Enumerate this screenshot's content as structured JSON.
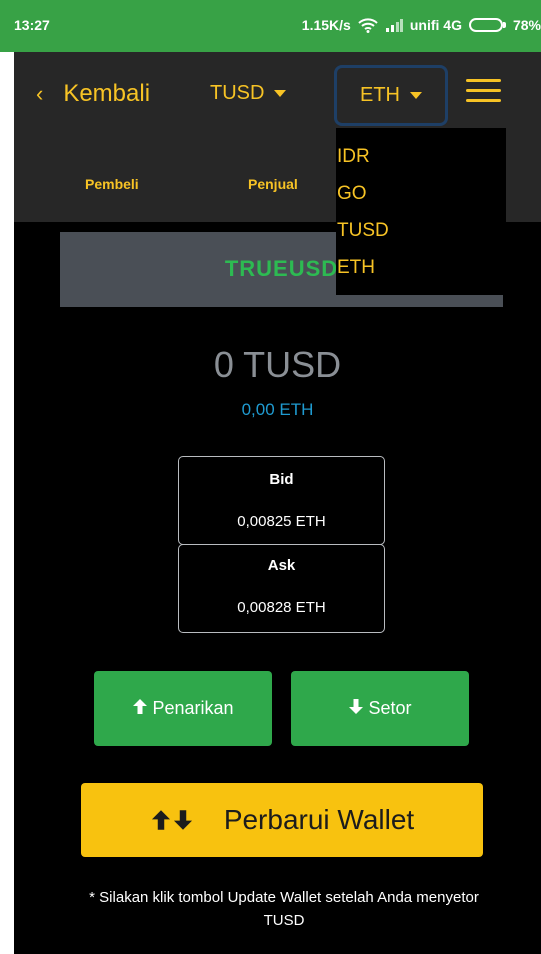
{
  "status_bar": {
    "time": "13:27",
    "network_speed": "1.15K/s",
    "carrier": "unifi 4G",
    "battery": "78%",
    "battery_level": 0.78
  },
  "navbar": {
    "back_label": "Kembali",
    "base_currency": "TUSD",
    "quote_currency": "ETH"
  },
  "subnav": {
    "tabs": [
      "Pembeli",
      "Penjual"
    ]
  },
  "dropdown": {
    "options": [
      "IDR",
      "GO",
      "TUSD",
      "ETH"
    ]
  },
  "wallet": {
    "coin_name": "TRUEUSD",
    "balance": "0 TUSD",
    "balance_converted": "0,00 ETH"
  },
  "prices": {
    "bid_label": "Bid",
    "bid_value": "0,00825 ETH",
    "ask_label": "Ask",
    "ask_value": "0,00828 ETH"
  },
  "actions": {
    "withdraw_label": "Penarikan",
    "deposit_label": "Setor",
    "refresh_label": "Perbarui Wallet"
  },
  "notice": "* Silakan klik tombol Update Wallet setelah Anda menyetor TUSD",
  "colors": {
    "accent": "#f7c325",
    "green": "#2fa84b",
    "statusbar": "#38a246",
    "link_blue": "#1f9bd1"
  }
}
